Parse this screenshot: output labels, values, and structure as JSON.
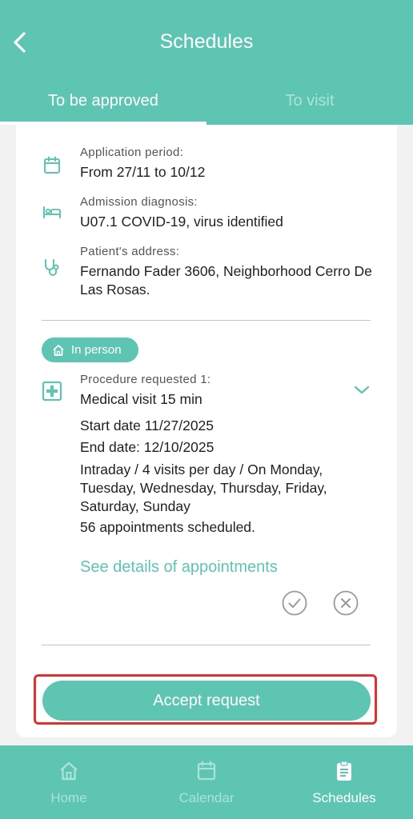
{
  "header": {
    "title": "Schedules",
    "tabs": [
      {
        "label": "To be approved",
        "active": true
      },
      {
        "label": "To visit",
        "active": false
      }
    ]
  },
  "card": {
    "application_period": {
      "label": "Application period:",
      "value": "From 27/11 to 10/12"
    },
    "admission_diagnosis": {
      "label": "Admission diagnosis:",
      "value": "U07.1 COVID-19, virus identified"
    },
    "patient_address": {
      "label": "Patient's address:",
      "value": "Fernando Fader 3606, Neighborhood Cerro De Las Rosas."
    },
    "badge": "In person",
    "procedure": {
      "label": "Procedure requested 1:",
      "name": "Medical visit 15 min",
      "start_date": "Start date 11/27/2025",
      "end_date": "End date: 12/10/2025",
      "frequency": "Intraday / 4 visits per day /  On Monday, Tuesday, Wednesday, Thursday, Friday, Saturday, Sunday",
      "appointments": "56 appointments scheduled."
    },
    "see_details": "See details of appointments",
    "accept_button": "Accept request"
  },
  "bottom_nav": [
    {
      "label": "Home",
      "icon": "home-icon",
      "active": false
    },
    {
      "label": "Calendar",
      "icon": "calendar-icon",
      "active": false
    },
    {
      "label": "Schedules",
      "icon": "clipboard-icon",
      "active": true
    }
  ],
  "colors": {
    "primary": "#5ec5b3",
    "inactive_tab": "#a9e3d9",
    "highlight_outline": "#e03131"
  }
}
